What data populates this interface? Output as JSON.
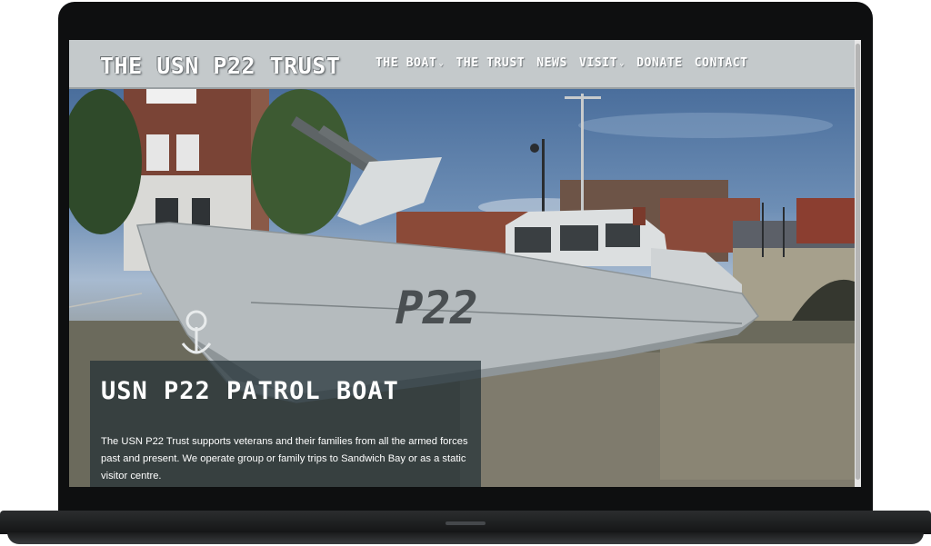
{
  "site": {
    "logo": "THE USN P22 TRUST"
  },
  "nav": {
    "items": [
      {
        "label": "THE BOAT",
        "dropdown": true
      },
      {
        "label": "THE TRUST",
        "dropdown": false
      },
      {
        "label": "NEWS",
        "dropdown": false
      },
      {
        "label": "VISIT",
        "dropdown": true
      },
      {
        "label": "DONATE",
        "dropdown": false
      },
      {
        "label": "CONTACT",
        "dropdown": false
      }
    ],
    "dropdown_icon": "chevron-down-icon"
  },
  "hero": {
    "title": "USN P22 PATROL BOAT",
    "text": "The USN P22 Trust supports veterans and their families from all the armed forces past and present. We operate group or family trips to Sandwich Bay or as a static visitor centre.",
    "hull_marking": "P22"
  },
  "colors": {
    "header_bg": "#c4c9cb",
    "overlay_bg": "#233036",
    "hull": "#b5bbbe",
    "sky": "#4a6e9c"
  }
}
